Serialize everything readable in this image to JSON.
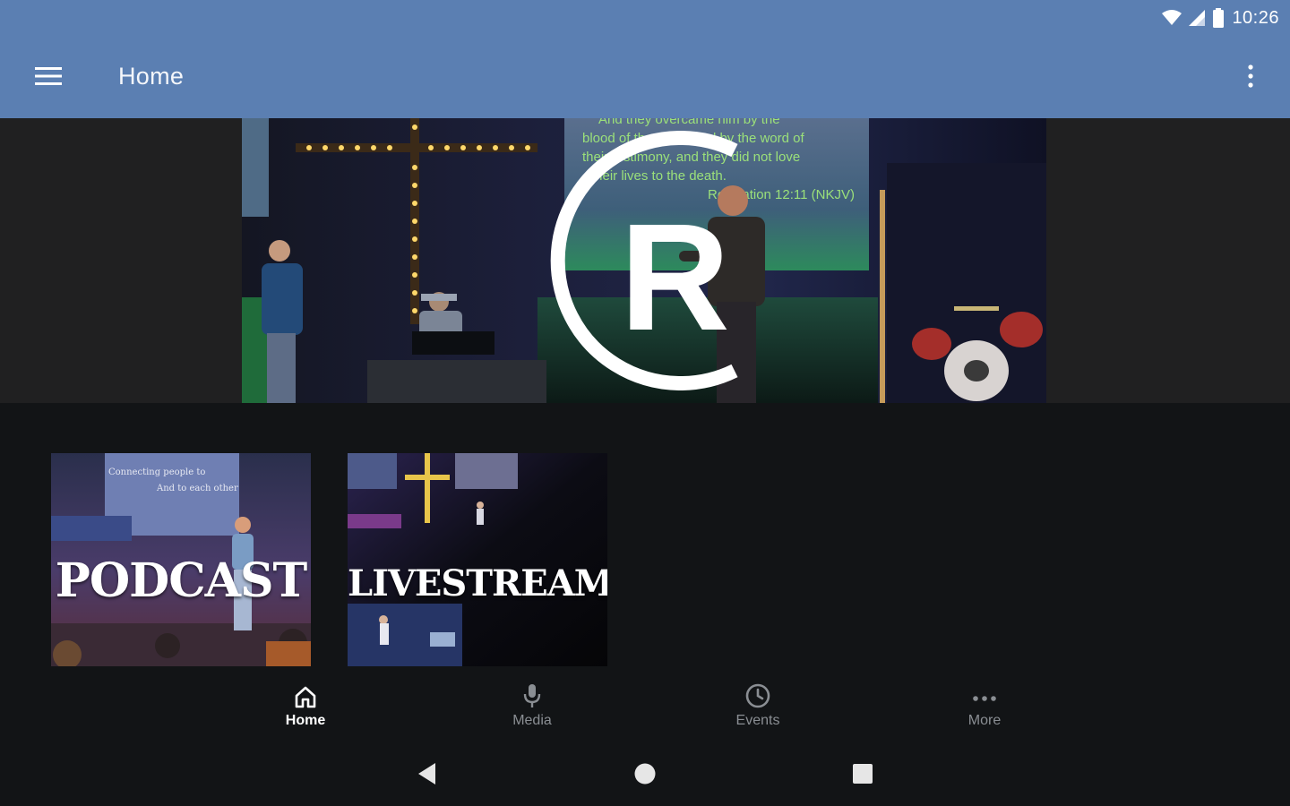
{
  "status_bar": {
    "time": "10:26",
    "icons": [
      "wifi-icon",
      "cell-signal-icon",
      "battery-icon"
    ]
  },
  "toolbar": {
    "menu_icon": "hamburger-menu-icon",
    "title": "Home",
    "overflow_icon": "more-vert-icon",
    "background": "#5b7fb2"
  },
  "hero": {
    "logo_letter": "R",
    "screen_text": [
      "And they overcame him by the",
      "blood of the Lamb and by the word of",
      "their testimony, and they did not love",
      "their lives to the death.",
      "Revelation 12:11 (NKJV)"
    ]
  },
  "tiles": [
    {
      "label": "PODCAST",
      "screen_text": [
        "Connecting people to",
        "And to each other"
      ]
    },
    {
      "label": "LIVESTREAM"
    }
  ],
  "bottom_nav": {
    "items": [
      {
        "label": "Home",
        "icon": "home-icon",
        "active": true
      },
      {
        "label": "Media",
        "icon": "microphone-icon",
        "active": false
      },
      {
        "label": "Events",
        "icon": "clock-icon",
        "active": false
      },
      {
        "label": "More",
        "icon": "more-horiz-icon",
        "active": false
      }
    ],
    "active_color": "#ffffff",
    "inactive_color": "#8a8e93"
  },
  "system_nav": {
    "icons": [
      "back-icon",
      "home-circle-icon",
      "recents-icon"
    ]
  }
}
